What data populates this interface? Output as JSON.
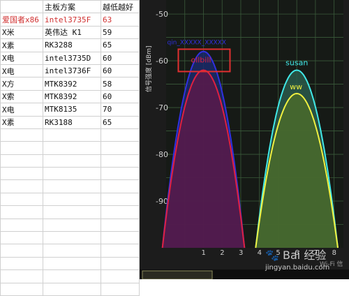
{
  "spreadsheet": {
    "headers": [
      "",
      "主板方案",
      "越低越好"
    ],
    "rows": [
      [
        "爱国者x86",
        "intel3735F",
        "63"
      ],
      [
        "X米",
        "英伟达 K1",
        "59"
      ],
      [
        "X素",
        "RK3288",
        "65"
      ],
      [
        "X电",
        "intel3735D",
        "60"
      ],
      [
        "X电",
        "intel3736F",
        "60"
      ],
      [
        "X方",
        "MTK8392",
        "58"
      ],
      [
        "X索",
        "MTK8392",
        "60"
      ],
      [
        "X电",
        "MTK8135",
        "70"
      ],
      [
        "X素",
        "RK3188",
        "65"
      ],
      [
        "",
        "",
        ""
      ],
      [
        "",
        "",
        ""
      ],
      [
        "",
        "",
        ""
      ],
      [
        "",
        "",
        ""
      ],
      [
        "",
        "",
        ""
      ],
      [
        "",
        "",
        ""
      ],
      [
        "",
        "",
        ""
      ],
      [
        "",
        "",
        ""
      ],
      [
        "",
        "",
        ""
      ],
      [
        "",
        "",
        ""
      ],
      [
        "",
        "",
        ""
      ],
      [
        "",
        "",
        ""
      ],
      [
        "",
        "",
        ""
      ]
    ],
    "highlight_color": "#d03030"
  },
  "wifi_app": {
    "y_axis_label": "信号强度 [dBm]",
    "footer_label": "Wi-Fi 信",
    "background_color": "#1c1c1c",
    "grid_color": "#3a5a3a"
  },
  "chart_data": {
    "type": "area",
    "ylabel": "信号强度 [dBm]",
    "ylim": [
      -100,
      -47
    ],
    "y_ticks": [
      -50,
      -60,
      -70,
      -80,
      -90
    ],
    "xlim": [
      -1,
      8.5
    ],
    "x_ticks": [
      1,
      2,
      3,
      4,
      5,
      6,
      7,
      8
    ],
    "grid": true,
    "series": [
      {
        "name": "qin_XXXXX_XXXXX",
        "channel": 1,
        "peak": -58,
        "color": "#3030e0",
        "fill": "#1a2a6a"
      },
      {
        "name": "ollbill",
        "channel": 1,
        "peak": -62,
        "color": "#e02040",
        "fill": "#5a1a4a"
      },
      {
        "name": "susan",
        "channel": 6,
        "peak": -62,
        "color": "#40e8e8",
        "fill": "#2a5a4a"
      },
      {
        "name": "ww",
        "channel": 6,
        "peak": -67,
        "color": "#f0f040",
        "fill": "#4a6a2a"
      }
    ],
    "annotation": {
      "type": "box",
      "around": "ollbill",
      "color": "#e03030"
    }
  },
  "watermark": {
    "brand": "Bai 经验",
    "url": "jingyan.baidu.com"
  }
}
